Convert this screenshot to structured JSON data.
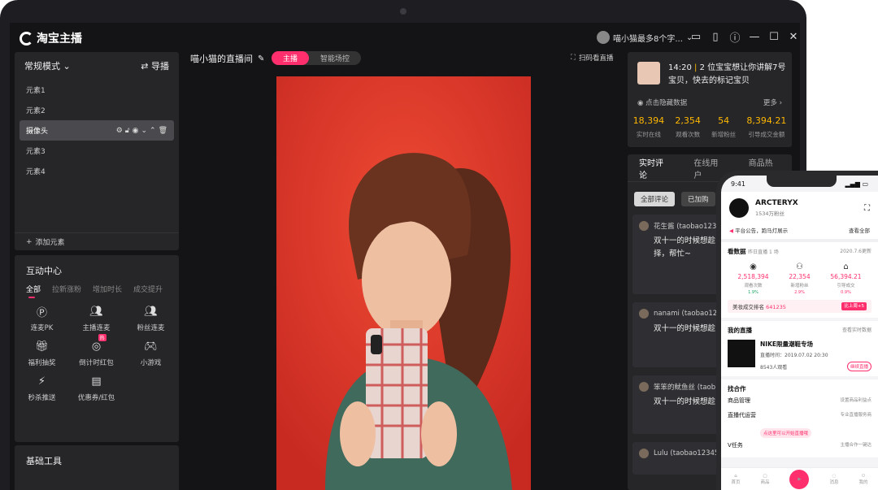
{
  "app": {
    "logo_text": "淘宝主播",
    "user_name": "喵小猫最多8个字..."
  },
  "left": {
    "mode_title": "常规模式",
    "guide_label": "导播",
    "elements": [
      "元素1",
      "元素2",
      "摄像头",
      "元素3",
      "元素4"
    ],
    "add_element": "添加元素",
    "interact_title": "互动中心",
    "interact_tabs": [
      "全部",
      "拉新涨粉",
      "增加时长",
      "成交提升"
    ],
    "interact_items": [
      "连麦PK",
      "主播连麦",
      "粉丝连麦",
      "福利抽奖",
      "倒计时红包",
      "小游戏",
      "秒杀推送",
      "优惠券/红包"
    ],
    "badge": "热",
    "tools_title": "基础工具"
  },
  "center": {
    "room_title": "喵小猫的直播间",
    "seg_active": "主播",
    "seg_other": "智能场控",
    "scan_label": "扫码看直播"
  },
  "right": {
    "notice_time": "14:20",
    "notice_text": "2 位宝宝想让你讲解7号宝贝，快去的标记宝贝",
    "hide_label": "点击隐藏数据",
    "more_label": "更多",
    "stats": [
      {
        "value": "18,394",
        "label": "实时在线"
      },
      {
        "value": "2,354",
        "label": "观看次数"
      },
      {
        "value": "54",
        "label": "新增粉丝"
      },
      {
        "value": "8,394.21",
        "label": "引导成交金额"
      }
    ],
    "comment_tabs": [
      "实时评论",
      "在线用户",
      "商品热度"
    ],
    "filters": [
      "全部评论",
      "已加购"
    ],
    "comments": [
      {
        "user": "花生酱 (taobao12345",
        "text": "双十一的时候想趁，不知道如何选择，帮忙~"
      },
      {
        "user": "nanami (taobao1234",
        "text": "双十一的时候想趁，不知道如何选择"
      },
      {
        "user": "笨笨的鱿鱼丝 (taob",
        "text": "双十一的时候想趁"
      },
      {
        "user": "Lulu (taobao123458",
        "text": ""
      }
    ]
  },
  "phone": {
    "time": "9:41",
    "brand": "ARCTERYX",
    "fans": "1534万粉丝",
    "notice": "平台公告，跑马灯展示",
    "notice_more": "查看全部",
    "data_title": "看数据",
    "data_sub": "昨日直播 1 场",
    "data_date": "2020.7.6更新",
    "metrics": [
      {
        "value": "2,518,394",
        "label": "观看次数",
        "delta": "1.9%"
      },
      {
        "value": "22,354",
        "label": "新增粉丝",
        "delta": "2.9%"
      },
      {
        "value": "56,394.21",
        "label": "引导成交",
        "delta": "0.9%"
      }
    ],
    "rank_label": "美妆成交排名",
    "rank_value": "641235",
    "rank_tag": "比上周+5",
    "live_title": "我的直播",
    "live_more": "查看实时数据",
    "live_name": "NIKE限量潮鞋专场",
    "live_time": "直播时间：2019.07.02 20:30",
    "live_viewers": "8543人观看",
    "live_btn": "继续直播",
    "coop_title": "找合作",
    "coop_items": [
      {
        "name": "商品管理",
        "hint": "设置商品利益点"
      },
      {
        "name": "直播代运营",
        "hint": "专业直播服务商"
      },
      {
        "name": "V任务",
        "hint": "主播合作一键达"
      }
    ],
    "tip": "点这里可以开始直播哦",
    "nav": [
      "首页",
      "商品",
      "",
      "消息",
      "我的"
    ]
  }
}
